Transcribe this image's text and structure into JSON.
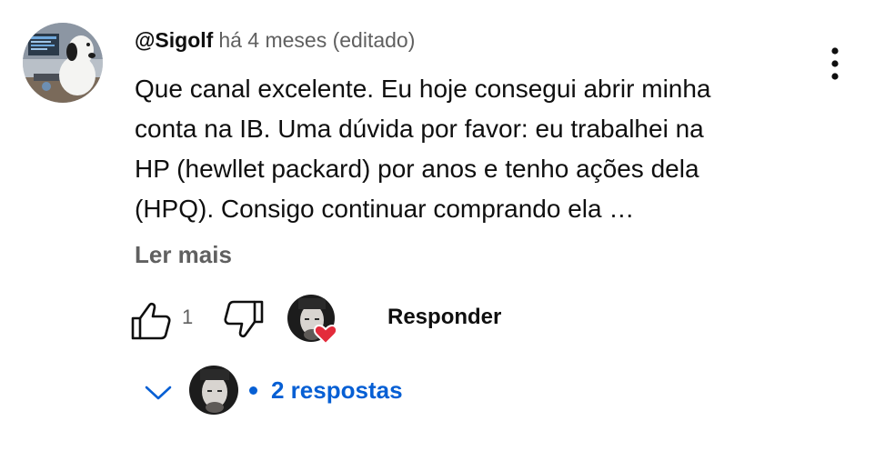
{
  "comment": {
    "author": "@Sigolf",
    "timestamp": "há 4 meses (editado)",
    "text_lines": [
      "Que canal excelente. Eu hoje consegui abrir minha",
      "conta na IB. Uma dúvida por favor: eu trabalhei na",
      "HP (hewllet packard) por anos e tenho ações dela",
      "(HPQ). Consigo continuar comprando ela …"
    ],
    "read_more_label": "Ler mais"
  },
  "actions": {
    "like_count": "1",
    "reply_label": "Responder",
    "icons": {
      "like": "thumb-up-icon",
      "dislike": "thumb-down-icon",
      "heart": "creator-heart-icon",
      "menu": "more-vert-icon"
    }
  },
  "replies": {
    "label": "2 respostas",
    "icon": "chevron-down-icon"
  },
  "colors": {
    "text": "#0f0f0f",
    "secondary": "#606060",
    "link": "#065fd4",
    "heart": "#e32b3b"
  }
}
